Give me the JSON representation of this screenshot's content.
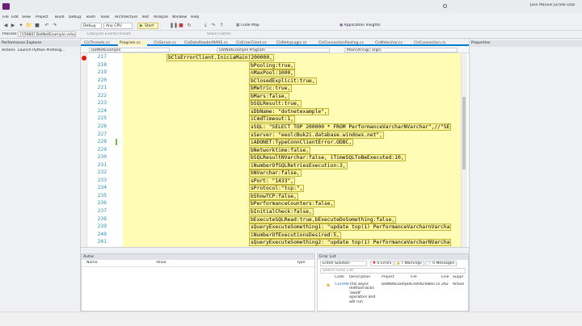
{
  "titlebar": {
    "user": "Jose Manuel Jurado Diaz"
  },
  "menu": [
    "File",
    "Edit",
    "View",
    "Project",
    "Build",
    "Debug",
    "Team",
    "Tools",
    "Architecture",
    "Test",
    "Analyze",
    "Window",
    "Help"
  ],
  "toolbar": {
    "config": "Debug",
    "platform": "Any CPU",
    "start_label": "Start",
    "code_map": "Code Map",
    "app_insights": "Application Insights"
  },
  "toolbar2": {
    "process_label": "Process:",
    "process_value": "[15980] DotNetExample.vshost.exe",
    "lifecycle": "Lifecycle Events",
    "thread": "Thread:",
    "stack_frame": "Stack Frame:"
  },
  "left_panel": {
    "title": "Performance Explorer",
    "actions": "Actions",
    "launch": "Launch Python Profiling..."
  },
  "tabs": [
    "ClsThreads.cs",
    "Program.cs",
    "ClsServer.cs",
    "ClsDataReaderMARS.cs",
    "ClsErrorClient.cs",
    "ClsRetryLogic.cs",
    "ClsConnectionPooling.cs",
    "ClsNVarchar.cs",
    "ClsConnection.cs"
  ],
  "navbar": {
    "project": "DotNetExample",
    "class": "DotNetExample.Program",
    "member": "Main(string[] args)"
  },
  "code": {
    "first_line": 217,
    "lines": [
      "bClsErrorClient.IniciaMain(200000,",
      "bPooling:true,",
      "nMaxPool:1000,",
      "bClosedExplicit:true,",
      "bMetric:true,",
      "bMars:false,",
      "bSQLResult:true,",
      "sDbName: \"dotnetexample\",",
      "iCmdTimeout:1,",
      "sSQL: \"SELECT TOP 200000 * FROM PerformanceVarcharNVarchar\",//\"SE",
      "sServer: \"eeolcBuk2i.database.windows.net\",",
      "iADONET:TypeConnClientError.ODBC,",
      "bNetworktime:false,",
      "bSQLResultNVarchar:false, iTimeSQLToBeExecuted:10,",
      "iNumberOfSQLRetriesExecution:3,",
      "bNVarchar:false,",
      "sPort: \"1433\",",
      "sProtocol:\"tcp:\",",
      "bShowTCP:false,",
      "bPerformanceCounters:false,",
      "bInitialCheck:false,",
      "bExecuteSQLRead:true,bExecuteDoSomething:false,",
      "sQueryExecuteSomething1: \"update top(1) PerformanceVarcharnVarcha",
      "iNumberOfExecutionsDesired:5,",
      "sQueryExecuteSomething2: \"update top(1) PerformanceVarcharNVarcha"
    ]
  },
  "right_panel": {
    "title": "Properties"
  },
  "autos": {
    "title": "Autos",
    "columns": [
      "Name",
      "Value",
      "Type"
    ]
  },
  "errors": {
    "title": "Error List",
    "scope": "Entire Solution",
    "errors_btn": "0 Errors",
    "warnings_btn": "7 Warnings",
    "messages_btn": "0 Messages",
    "search_placeholder": "Search Error List",
    "columns": [
      "Code",
      "Description",
      "Project",
      "File",
      "Line",
      "Suppr"
    ],
    "row": {
      "code": "CS1998",
      "description": "This async method lacks 'await' operators and will run",
      "project": "DotNetExample",
      "file": "ClsAADToken.cs",
      "line": "292",
      "suppression": "Active"
    }
  },
  "colors": {
    "accent": "#007acc",
    "highlight": "#fff59d",
    "line_number": "#2b91af",
    "breakpoint": "#e51400"
  }
}
